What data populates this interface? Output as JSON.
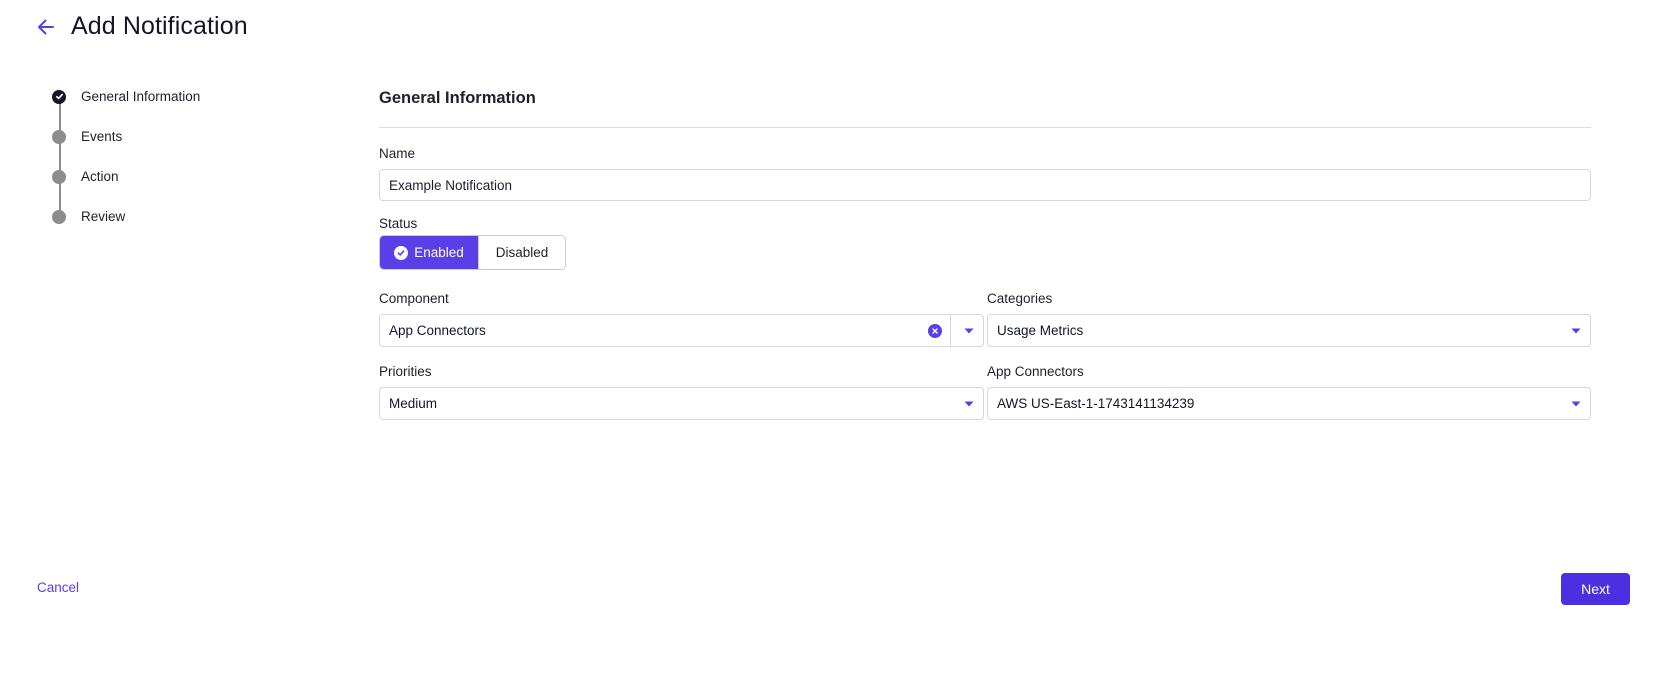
{
  "header": {
    "title": "Add Notification",
    "back_icon": "arrow-left-icon"
  },
  "stepper": {
    "steps": [
      {
        "label": "General Information",
        "state": "current"
      },
      {
        "label": "Events",
        "state": "pending"
      },
      {
        "label": "Action",
        "state": "pending"
      },
      {
        "label": "Review",
        "state": "pending"
      }
    ]
  },
  "form": {
    "section_title": "General Information",
    "name": {
      "label": "Name",
      "value": "Example Notification"
    },
    "status": {
      "label": "Status",
      "options": [
        "Enabled",
        "Disabled"
      ],
      "selected": "Enabled"
    },
    "component": {
      "label": "Component",
      "value": "App Connectors"
    },
    "categories": {
      "label": "Categories",
      "value": "Usage Metrics"
    },
    "priorities": {
      "label": "Priorities",
      "value": "Medium"
    },
    "app_connectors": {
      "label": "App Connectors",
      "value": "AWS US-East-1-1743141134239"
    }
  },
  "footer": {
    "cancel_label": "Cancel",
    "next_label": "Next"
  },
  "colors": {
    "accent": "#5a3ee8",
    "primary_button": "#4b2fe0",
    "step_done": "#13152b",
    "step_pending": "#8c8c8c",
    "border": "#d6d6de"
  }
}
